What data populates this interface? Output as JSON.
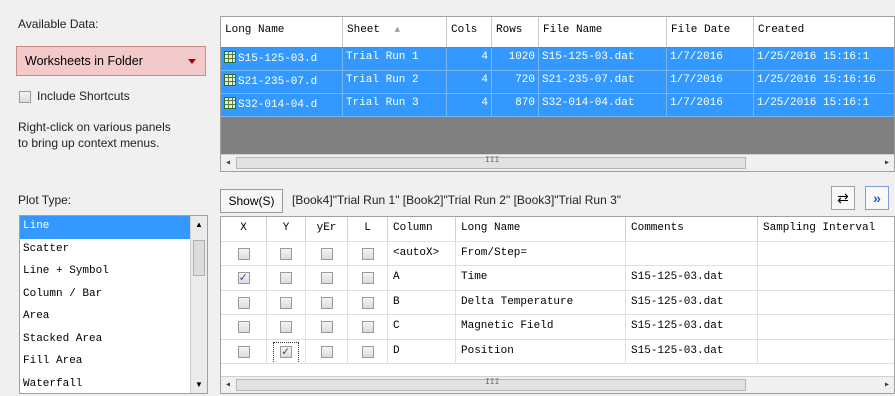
{
  "available": {
    "label": "Available Data:",
    "selected": "Worksheets in Folder",
    "include_shortcuts": "Include Shortcuts",
    "hint_line1": "Right-click on various panels",
    "hint_line2": "to bring up context menus."
  },
  "plot_type": {
    "label": "Plot Type:",
    "items": [
      "Line",
      "Scatter",
      "Line + Symbol",
      "Column / Bar",
      "Area",
      "Stacked Area",
      "Fill Area",
      "Waterfall"
    ],
    "selected_index": 0
  },
  "top_grid": {
    "columns": [
      "Long Name",
      "Sheet",
      "Cols",
      "Rows",
      "File Name",
      "File Date",
      "Created"
    ],
    "sort_indicator": "▲",
    "rows": [
      {
        "long_name": "S15-125-03.d",
        "sheet": "Trial Run 1",
        "cols": "4",
        "rows": "1020",
        "file_name": "S15-125-03.dat",
        "file_date": "1/7/2016",
        "created": "1/25/2016 15:16:1"
      },
      {
        "long_name": "S21-235-07.d",
        "sheet": "Trial Run 2",
        "cols": "4",
        "rows": "720",
        "file_name": "S21-235-07.dat",
        "file_date": "1/7/2016",
        "created": "1/25/2016 15:16:16"
      },
      {
        "long_name": "S32-014-04.d",
        "sheet": "Trial Run 3",
        "cols": "4",
        "rows": "870",
        "file_name": "S32-014-04.dat",
        "file_date": "1/7/2016",
        "created": "1/25/2016 15:16:1"
      }
    ],
    "scroll_grip": "III"
  },
  "show_bar": {
    "button": "Show(S)",
    "text": "[Book4]\"Trial Run 1\" [Book2]\"Trial Run 2\" [Book3]\"Trial Run 3\"",
    "swap_icon": "⇄",
    "expand_icon": "»"
  },
  "bottom_grid": {
    "columns": [
      "X",
      "Y",
      "yEr",
      "L",
      "Column",
      "Long Name",
      "Comments",
      "Sampling Interval"
    ],
    "rows": [
      {
        "x": false,
        "y": false,
        "yer": false,
        "l": false,
        "column": "<autoX>",
        "long_name": "From/Step=",
        "comments": ""
      },
      {
        "x": true,
        "y": false,
        "yer": false,
        "l": false,
        "column": "A",
        "long_name": "Time",
        "comments": "S15-125-03.dat"
      },
      {
        "x": false,
        "y": false,
        "yer": false,
        "l": false,
        "column": "B",
        "long_name": "Delta Temperature",
        "comments": "S15-125-03.dat"
      },
      {
        "x": false,
        "y": false,
        "yer": false,
        "l": false,
        "column": "C",
        "long_name": "Magnetic Field",
        "comments": "S15-125-03.dat"
      },
      {
        "x": false,
        "y": true,
        "yer": false,
        "l": false,
        "column": "D",
        "long_name": "Position",
        "comments": "S15-125-03.dat"
      }
    ],
    "scroll_grip": "III"
  },
  "colors": {
    "selection": "#3399ff",
    "dropdown_bg": "#f3c9c9",
    "header_bg": "#ffffff"
  }
}
